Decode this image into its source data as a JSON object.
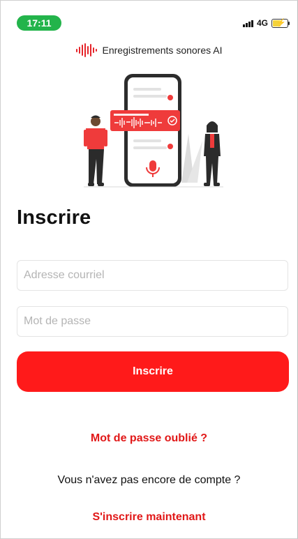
{
  "status_bar": {
    "time": "17:11",
    "network": "4G",
    "pill_color": "#23b44b",
    "icons": [
      "signal-icon",
      "battery-charging-icon"
    ]
  },
  "brand": {
    "name": "Enregistrements sonores AI",
    "logo_icon": "sound-wave-icon",
    "accent": "#e5242a"
  },
  "illustration": {
    "icons": [
      "phone-illustration",
      "audio-waveform-icon",
      "check-circle-icon",
      "microphone-icon",
      "person-man",
      "person-woman"
    ]
  },
  "form": {
    "title": "Inscrire",
    "email_placeholder": "Adresse courriel",
    "password_placeholder": "Mot de passe",
    "submit_label": "Inscrire",
    "forgot_password": "Mot de passe oublié ?",
    "no_account_text": "Vous n'avez pas encore de compte ?",
    "signup_link": "S'inscrire maintenant"
  },
  "colors": {
    "primary": "#ff1a1a",
    "link": "#e11818"
  }
}
